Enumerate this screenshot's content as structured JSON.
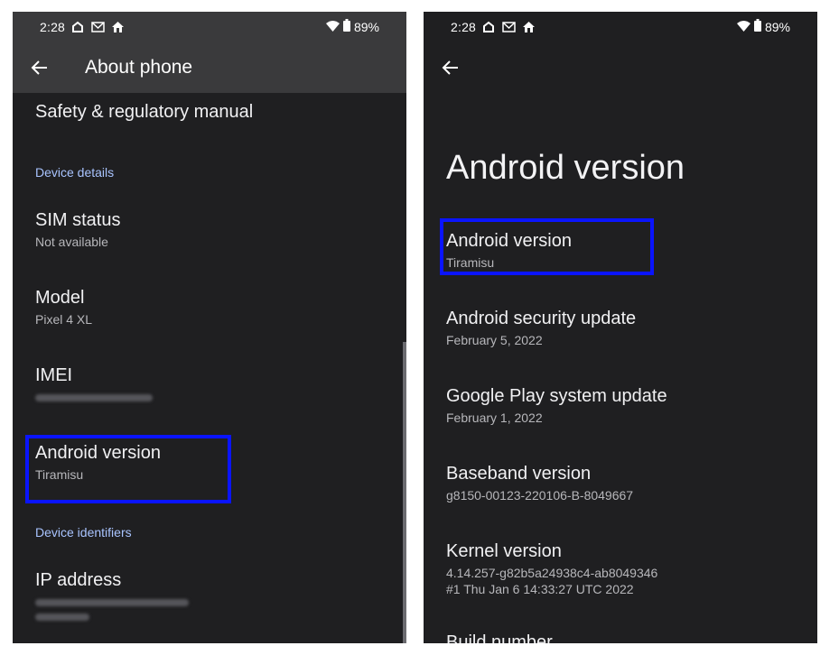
{
  "status": {
    "time": "2:28",
    "battery": "89%",
    "icons": [
      "home-outline-icon",
      "mail-icon",
      "house-icon"
    ]
  },
  "left": {
    "appbar_title": "About phone",
    "items": {
      "safety": {
        "title": "Safety & regulatory manual"
      },
      "section_device_details": "Device details",
      "sim": {
        "title": "SIM status",
        "subtitle": "Not available"
      },
      "model": {
        "title": "Model",
        "subtitle": "Pixel 4 XL"
      },
      "imei": {
        "title": "IMEI"
      },
      "android": {
        "title": "Android version",
        "subtitle": "Tiramisu"
      },
      "section_device_identifiers": "Device identifiers",
      "ip": {
        "title": "IP address"
      }
    }
  },
  "right": {
    "page_title": "Android version",
    "items": {
      "android": {
        "title": "Android version",
        "subtitle": "Tiramisu"
      },
      "security": {
        "title": "Android security update",
        "subtitle": "February 5, 2022"
      },
      "play": {
        "title": "Google Play system update",
        "subtitle": "February 1, 2022"
      },
      "baseband": {
        "title": "Baseband version",
        "subtitle": "g8150-00123-220106-B-8049667"
      },
      "kernel": {
        "title": "Kernel version",
        "subtitle": "4.14.257-g82b5a24938c4-ab8049346",
        "subtitle2": "#1 Thu Jan 6 14:33:27 UTC 2022"
      },
      "build": {
        "title": "Build number"
      }
    }
  },
  "colors": {
    "highlight": "#0a14ff",
    "section": "#a9c4ff",
    "background": "#1f1f21",
    "appbar": "#3a3a3c"
  }
}
